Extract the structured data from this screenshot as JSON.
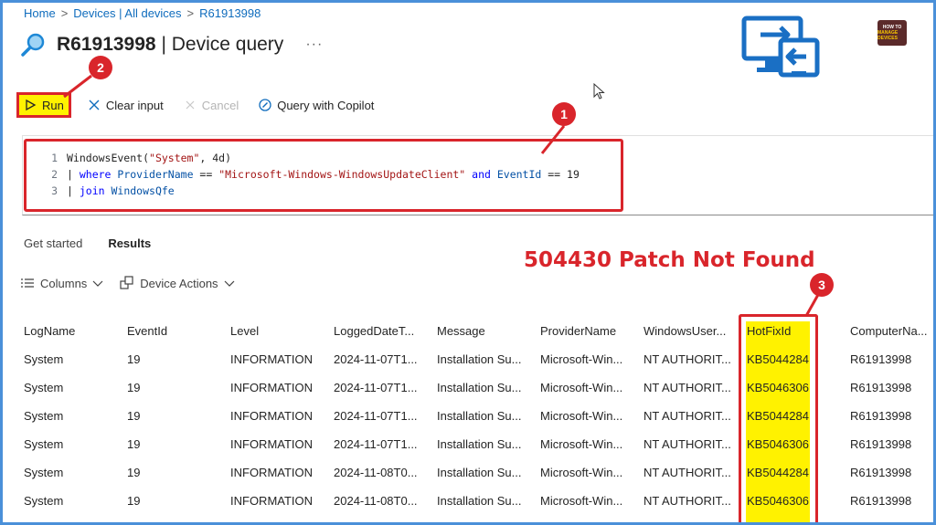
{
  "breadcrumb": [
    "Home",
    "Devices | All devices",
    "R61913998"
  ],
  "title": {
    "device": "R61913998",
    "suffix": "| Device query",
    "more": "···"
  },
  "brand_logo": {
    "line1": "HOW TO",
    "line2": "MANAGE DEVICES"
  },
  "toolbar": {
    "run": "Run",
    "clear": "Clear input",
    "cancel": "Cancel",
    "copilot": "Query with Copilot"
  },
  "query": {
    "line_numbers": [
      "1",
      "2",
      "3"
    ],
    "line1": {
      "fn": "WindowsEvent(",
      "arg1": "\"System\"",
      "rest": ", 4d)"
    },
    "line2": {
      "pipe": "| ",
      "where": "where ",
      "prop1": "ProviderName",
      "eq": " == ",
      "val": "\"Microsoft-Windows-WindowsUpdateClient\"",
      "and": " and ",
      "prop2": "EventId",
      "eq2": " == 19"
    },
    "line3": {
      "pipe": "| ",
      "join": "join ",
      "table": "WindowsQfe"
    }
  },
  "tabs": {
    "get_started": "Get started",
    "results": "Results"
  },
  "annotation": "504430 Patch Not Found",
  "badges": [
    "1",
    "2",
    "3"
  ],
  "results_toolbar": {
    "columns": "Columns",
    "device_actions": "Device Actions"
  },
  "table": {
    "headers": [
      "LogName",
      "EventId",
      "Level",
      "LoggedDateT...",
      "Message",
      "ProviderName",
      "WindowsUser...",
      "HotFixId",
      "ComputerNa..."
    ],
    "rows": [
      [
        "System",
        "19",
        "INFORMATION",
        "2024-11-07T1...",
        "Installation Su...",
        "Microsoft-Win...",
        "NT AUTHORIT...",
        "KB5044284",
        "R61913998"
      ],
      [
        "System",
        "19",
        "INFORMATION",
        "2024-11-07T1...",
        "Installation Su...",
        "Microsoft-Win...",
        "NT AUTHORIT...",
        "KB5046306",
        "R61913998"
      ],
      [
        "System",
        "19",
        "INFORMATION",
        "2024-11-07T1...",
        "Installation Su...",
        "Microsoft-Win...",
        "NT AUTHORIT...",
        "KB5044284",
        "R61913998"
      ],
      [
        "System",
        "19",
        "INFORMATION",
        "2024-11-07T1...",
        "Installation Su...",
        "Microsoft-Win...",
        "NT AUTHORIT...",
        "KB5046306",
        "R61913998"
      ],
      [
        "System",
        "19",
        "INFORMATION",
        "2024-11-08T0...",
        "Installation Su...",
        "Microsoft-Win...",
        "NT AUTHORIT...",
        "KB5044284",
        "R61913998"
      ],
      [
        "System",
        "19",
        "INFORMATION",
        "2024-11-08T0...",
        "Installation Su...",
        "Microsoft-Win...",
        "NT AUTHORIT...",
        "KB5046306",
        "R61913998"
      ]
    ]
  },
  "colors": {
    "accent": "#0f6cbd",
    "highlight": "#fff200",
    "annotation_red": "#d9252b"
  }
}
